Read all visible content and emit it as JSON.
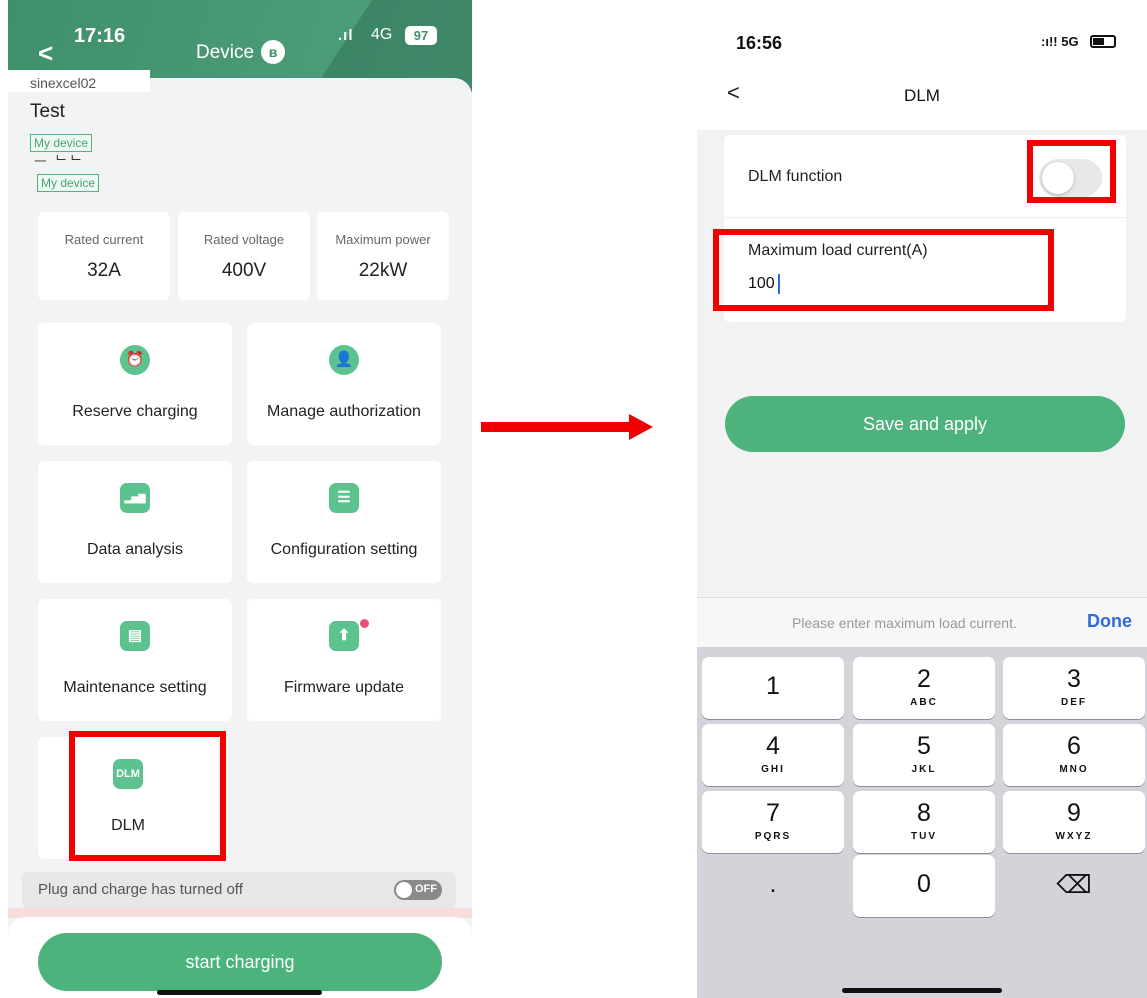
{
  "left_screen": {
    "status_time": "17:16",
    "status_signal": ".ıl",
    "status_network": "4G",
    "status_battery": "97",
    "header_title": "Device",
    "bluetooth_symbol": "ʙ",
    "device_id": "sinexcel02",
    "device_name": "Test",
    "tag_primary": "My device",
    "tag_secondary": "My device",
    "overlap_text": "ᅳ ᄂᄂ",
    "stats": [
      {
        "label": "Rated current",
        "value": "32A"
      },
      {
        "label": "Rated voltage",
        "value": "400V"
      },
      {
        "label": "Maximum power",
        "value": "22kW"
      }
    ],
    "cards": [
      {
        "label": "Reserve charging",
        "icon": "alarm-clock-icon",
        "glyph": "⏰"
      },
      {
        "label": "Manage authorization",
        "icon": "user-gear-icon",
        "glyph": "👤"
      },
      {
        "label": "Data analysis",
        "icon": "bar-chart-icon",
        "glyph": "▂▅▇"
      },
      {
        "label": "Configuration setting",
        "icon": "sliders-icon",
        "glyph": "☰"
      },
      {
        "label": "Maintenance setting",
        "icon": "maintenance-screen-icon",
        "glyph": "▤"
      },
      {
        "label": "Firmware update",
        "icon": "upload-arrow-icon",
        "glyph": "⬆"
      },
      {
        "label": "DLM",
        "icon": "dlm-icon",
        "glyph": "DLM"
      }
    ],
    "plug_charge_text": "Plug and charge has turned off",
    "plug_charge_toggle": "OFF",
    "start_button": "start charging"
  },
  "right_screen": {
    "status_time": "16:56",
    "status_network": ":ı!! 5G",
    "back_symbol": "<",
    "title": "DLM",
    "dlm_function_label": "DLM function",
    "dlm_function_on": false,
    "max_load_label": "Maximum load current(A)",
    "max_load_value": "100",
    "save_button": "Save and apply",
    "keyboard_hint": "Please enter maximum load current.",
    "keyboard_done": "Done",
    "keys": [
      {
        "num": "1",
        "letters": ""
      },
      {
        "num": "2",
        "letters": "ABC"
      },
      {
        "num": "3",
        "letters": "DEF"
      },
      {
        "num": "4",
        "letters": "GHI"
      },
      {
        "num": "5",
        "letters": "JKL"
      },
      {
        "num": "6",
        "letters": "MNO"
      },
      {
        "num": "7",
        "letters": "PQRS"
      },
      {
        "num": "8",
        "letters": "TUV"
      },
      {
        "num": "9",
        "letters": "WXYZ"
      },
      {
        "num": ".",
        "letters": ""
      },
      {
        "num": "0",
        "letters": ""
      },
      {
        "num": "⌫",
        "letters": ""
      }
    ]
  },
  "colors": {
    "brand_green": "#4cb37d",
    "header_green": "#3f8f6b",
    "highlight_red": "#f10000",
    "ios_blue": "#2f6bd8"
  }
}
